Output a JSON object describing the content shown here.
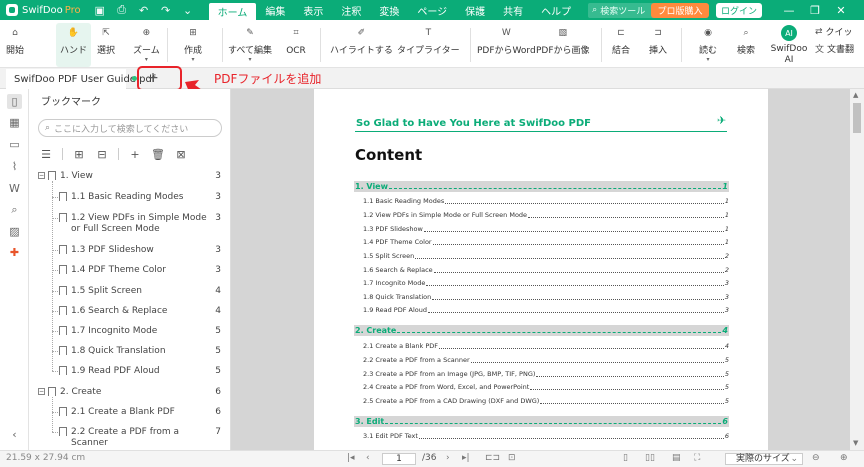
{
  "titlebar": {
    "app_name": "SwifDoo",
    "app_edition": "Pro",
    "menus": [
      "ホーム",
      "編集",
      "表示",
      "注釈",
      "変換",
      "ページ",
      "保護",
      "共有",
      "ヘルプ"
    ],
    "active_menu": "ホーム",
    "search_placeholder": "検索ツール",
    "pro_button": "プロ版購入",
    "login_button": "ログイン"
  },
  "ribbon": {
    "tools": [
      {
        "label": "開始",
        "icon": "home-icon"
      },
      {
        "label": "ハンド",
        "icon": "hand-icon"
      },
      {
        "label": "選択",
        "icon": "cursor-icon"
      },
      {
        "label": "ズーム",
        "icon": "zoom-icon"
      },
      {
        "label": "作成",
        "icon": "create-icon"
      },
      {
        "label": "すべて編集",
        "icon": "edit-all-icon"
      },
      {
        "label": "OCR",
        "icon": "ocr-icon"
      },
      {
        "label": "ハイライトする",
        "icon": "highlighter-icon"
      },
      {
        "label": "タイプライター",
        "icon": "typewriter-icon"
      },
      {
        "label": "PDFからWord",
        "icon": "pdf-to-word-icon"
      },
      {
        "label": "PDFから画像",
        "icon": "pdf-to-image-icon"
      },
      {
        "label": "結合",
        "icon": "merge-icon"
      },
      {
        "label": "挿入",
        "icon": "insert-icon"
      },
      {
        "label": "読む",
        "icon": "read-aloud-icon"
      },
      {
        "label": "検索",
        "icon": "search-doc-icon"
      },
      {
        "label": "SwifDoo AI",
        "icon": "ai-icon"
      },
      {
        "label": "クイッ",
        "icon": "quick-translate-icon"
      },
      {
        "label": "文書翻",
        "icon": "doc-translate-icon"
      }
    ]
  },
  "tabs": {
    "doc_tab": "SwifDoo PDF User Guide.pdf",
    "add_tab": "+",
    "annotation": "PDFファイルを追加",
    "page_count_badge": "1"
  },
  "bookmark_panel": {
    "title": "ブックマーク",
    "search_placeholder": "ここに入力して検索してください",
    "items": [
      {
        "label": "1. View",
        "page": "3",
        "level": 0
      },
      {
        "label": "1.1 Basic Reading Modes",
        "page": "3",
        "level": 1
      },
      {
        "label": "1.2 View PDFs in Simple Mode or Full Screen Mode",
        "page": "3",
        "level": 1
      },
      {
        "label": "1.3 PDF Slideshow",
        "page": "3",
        "level": 1
      },
      {
        "label": "1.4 PDF Theme Color",
        "page": "3",
        "level": 1
      },
      {
        "label": "1.5 Split Screen",
        "page": "4",
        "level": 1
      },
      {
        "label": "1.6 Search & Replace",
        "page": "4",
        "level": 1
      },
      {
        "label": "1.7 Incognito Mode",
        "page": "5",
        "level": 1
      },
      {
        "label": "1.8 Quick Translation",
        "page": "5",
        "level": 1
      },
      {
        "label": "1.9 Read PDF Aloud",
        "page": "5",
        "level": 1
      },
      {
        "label": "2. Create",
        "page": "6",
        "level": 0
      },
      {
        "label": "2.1 Create a Blank PDF",
        "page": "6",
        "level": 1
      },
      {
        "label": "2.2 Create a PDF from a Scanner",
        "page": "7",
        "level": 1
      }
    ]
  },
  "document": {
    "page_header": "So Glad to Have You Here at SwifDoo PDF",
    "heading": "Content",
    "toc": [
      {
        "text": "1. View",
        "page": "1",
        "type": "sec"
      },
      {
        "text": "1.1 Basic Reading Modes",
        "page": "1",
        "type": "sub"
      },
      {
        "text": "1.2 View PDFs in Simple Mode or Full Screen Mode",
        "page": "1",
        "type": "sub"
      },
      {
        "text": "1.3 PDF Slideshow",
        "page": "1",
        "type": "sub"
      },
      {
        "text": "1.4 PDF Theme Color",
        "page": "1",
        "type": "sub"
      },
      {
        "text": "1.5 Split Screen",
        "page": "2",
        "type": "sub"
      },
      {
        "text": "1.6 Search & Replace",
        "page": "2",
        "type": "sub"
      },
      {
        "text": "1.7 Incognito Mode",
        "page": "3",
        "type": "sub"
      },
      {
        "text": "1.8 Quick Translation",
        "page": "3",
        "type": "sub"
      },
      {
        "text": "1.9 Read PDF Aloud",
        "page": "3",
        "type": "sub"
      },
      {
        "text": "2. Create",
        "page": "4",
        "type": "sec"
      },
      {
        "text": "2.1 Create a Blank PDF",
        "page": "4",
        "type": "sub"
      },
      {
        "text": "2.2 Create a PDF from a Scanner",
        "page": "5",
        "type": "sub"
      },
      {
        "text": "2.3 Create a PDF from an Image (JPG, BMP, TIF, PNG)",
        "page": "5",
        "type": "sub"
      },
      {
        "text": "2.4 Create a PDF from Word, Excel, and PowerPoint",
        "page": "5",
        "type": "sub"
      },
      {
        "text": "2.5 Create a PDF from a CAD Drawing (DXF and DWG)",
        "page": "5",
        "type": "sub"
      },
      {
        "text": "3. Edit",
        "page": "6",
        "type": "sec"
      },
      {
        "text": "3.1 Edit PDF Text",
        "page": "6",
        "type": "sub"
      }
    ]
  },
  "statusbar": {
    "page_size": "21.59 x 27.94 cm",
    "current_page": "1",
    "total_pages": "/36",
    "fit_option": "実際のサイズ"
  }
}
